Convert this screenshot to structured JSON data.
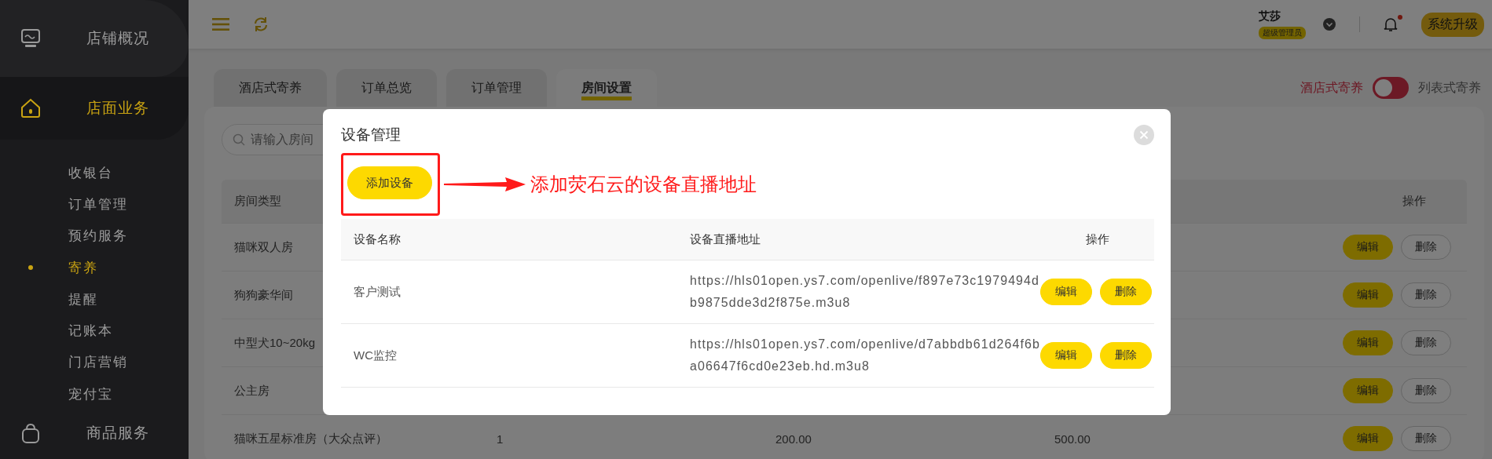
{
  "sidebar": {
    "items": [
      {
        "label": "店铺概况",
        "selected": false
      },
      {
        "label": "店面业务",
        "selected": true,
        "children": [
          {
            "label": "收银台",
            "selected": false
          },
          {
            "label": "订单管理",
            "selected": false
          },
          {
            "label": "预约服务",
            "selected": false
          },
          {
            "label": "寄养",
            "selected": true
          },
          {
            "label": "提醒",
            "selected": false
          },
          {
            "label": "记账本",
            "selected": false
          },
          {
            "label": "门店营销",
            "selected": false
          },
          {
            "label": "宠付宝",
            "selected": false
          }
        ]
      },
      {
        "label": "商品服务",
        "selected": false
      }
    ]
  },
  "header": {
    "user_name": "艾莎",
    "role_badge": "超级管理员",
    "has_unread": true,
    "upgrade_button": "系统升级"
  },
  "tabs": [
    {
      "label": "酒店式寄养",
      "selected": false
    },
    {
      "label": "订单总览",
      "selected": false
    },
    {
      "label": "订单管理",
      "selected": false
    },
    {
      "label": "房间设置",
      "selected": true
    }
  ],
  "view_toggle": {
    "left_label": "酒店式寄养",
    "right_label": "列表式寄养",
    "on": false
  },
  "search": {
    "placeholder": "请输入房间"
  },
  "table": {
    "columns": [
      "房间类型",
      "操作"
    ],
    "rows": [
      {
        "cells": [
          "猫咪双人房"
        ],
        "actions": [
          "编辑",
          "删除"
        ]
      },
      {
        "cells": [
          "狗狗豪华间"
        ],
        "actions": [
          "编辑",
          "删除"
        ]
      },
      {
        "cells": [
          "中型犬10~20kg"
        ],
        "actions": [
          "编辑",
          "删除"
        ]
      },
      {
        "cells": [
          "公主房"
        ],
        "actions": [
          "编辑",
          "删除"
        ]
      },
      {
        "cells": [
          "猫咪五星标准房（大众点评）",
          "1",
          "200.00",
          "500.00"
        ],
        "actions": [
          "编辑",
          "删除"
        ]
      }
    ]
  },
  "modal": {
    "title": "设备管理",
    "add_button": "添加设备",
    "annotation": "添加荧石云的设备直播地址",
    "columns": [
      "设备名称",
      "设备直播地址",
      "操作"
    ],
    "rows": [
      {
        "name": "客户测试",
        "url": "https://hls01open.ys7.com/openlive/f897e73c1979494db9875dde3d2f875e.m3u8",
        "actions": [
          "编辑",
          "删除"
        ]
      },
      {
        "name": "WC监控",
        "url": "https://hls01open.ys7.com/openlive/d7abbdb61d264f6ba06647f6cd0e23eb.hd.m3u8",
        "actions": [
          "编辑",
          "删除"
        ]
      }
    ]
  }
}
